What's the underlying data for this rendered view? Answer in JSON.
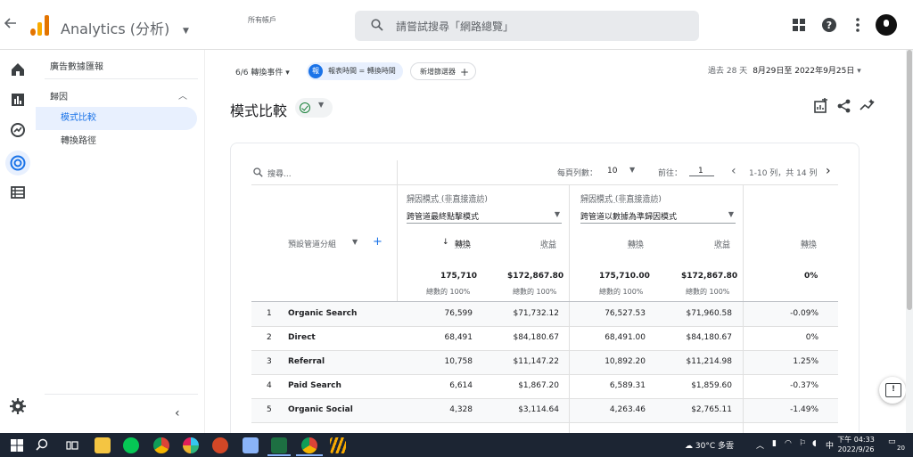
{
  "topbar": {
    "app_name": "Analytics (分析)",
    "account_label": "所有帳戶",
    "search_placeholder": "請嘗試搜尋「網路總覽」"
  },
  "nav": {
    "title": "廣告數據匯報",
    "section": "歸因",
    "items": [
      {
        "label": "模式比較",
        "active": true
      },
      {
        "label": "轉換路徑",
        "active": false
      }
    ]
  },
  "filters": {
    "events": "6/6 轉換事件 ▾",
    "chip_badge": "報",
    "chip": "報表時間 = 轉換時間",
    "add_comparison": "新增篩選器",
    "date_prefix": "過去 28 天",
    "date_range": "8月29日至 2022年9月25日"
  },
  "page": {
    "title": "模式比較"
  },
  "table": {
    "search_placeholder": "搜尋...",
    "rows_per_page_label": "每頁列數：",
    "rows_per_page": "10",
    "goto_label": "前往：",
    "goto_value": "1",
    "pagination": "1-10 列，共 14 列",
    "dimension_label": "預設管道分組",
    "model_a_label": "歸因模式 (非直接造訪)",
    "model_a_value": "跨管道最終點擊模式",
    "model_b_label": "歸因模式 (非直接造訪)",
    "model_b_value": "跨管道以數據為準歸因模式",
    "col_conversions": "轉換",
    "col_revenue": "收益",
    "col_change": "轉換",
    "sort_arrow": "↓",
    "totals": {
      "a_conv": "175,710",
      "a_rev": "$172,867.80",
      "b_conv": "175,710.00",
      "b_rev": "$172,867.80",
      "change": "0%",
      "pct_label": "總數的 100%"
    },
    "rows": [
      {
        "idx": "1",
        "channel": "Organic Search",
        "a_conv": "76,599",
        "a_rev": "$71,732.12",
        "b_conv": "76,527.53",
        "b_rev": "$71,960.58",
        "change": "-0.09%"
      },
      {
        "idx": "2",
        "channel": "Direct",
        "a_conv": "68,491",
        "a_rev": "$84,180.67",
        "b_conv": "68,491.00",
        "b_rev": "$84,180.67",
        "change": "0%"
      },
      {
        "idx": "3",
        "channel": "Referral",
        "a_conv": "10,758",
        "a_rev": "$11,147.22",
        "b_conv": "10,892.20",
        "b_rev": "$11,214.98",
        "change": "1.25%"
      },
      {
        "idx": "4",
        "channel": "Paid Search",
        "a_conv": "6,614",
        "a_rev": "$1,867.20",
        "b_conv": "6,589.31",
        "b_rev": "$1,859.60",
        "change": "-0.37%"
      },
      {
        "idx": "5",
        "channel": "Organic Social",
        "a_conv": "4,328",
        "a_rev": "$3,114.64",
        "b_conv": "4,263.46",
        "b_rev": "$2,765.11",
        "change": "-1.49%"
      }
    ]
  },
  "taskbar": {
    "weather": "30°C 多雲",
    "ime": "中",
    "time": "下午 04:33",
    "date": "2022/9/26",
    "notifications": "20"
  },
  "colors": {
    "accent": "#1a73e8",
    "logo_orange": "#f9ab00",
    "logo_dark": "#e37400"
  }
}
